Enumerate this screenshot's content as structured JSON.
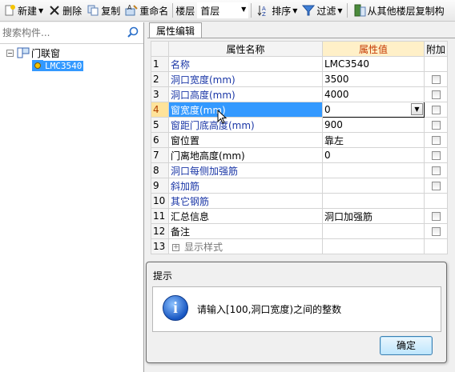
{
  "toolbar": {
    "new_label": "新建",
    "delete_label": "删除",
    "copy_label": "复制",
    "rename_label": "重命名",
    "floor_label": "楼层",
    "floor_value": "首层",
    "sort_label": "排序",
    "filter_label": "过滤",
    "copy_from_floor_label": "从其他楼层复制构"
  },
  "sidebar": {
    "search_placeholder": "搜索构件...",
    "tree": {
      "group_label": "门联窗",
      "item_label": "LMC3540"
    }
  },
  "panel": {
    "tab_label": "属性编辑",
    "columns": {
      "name": "属性名称",
      "value": "属性值",
      "extra": "附加"
    },
    "rows": [
      {
        "num": "1",
        "name": "名称",
        "value": "LMC3540",
        "checkbox": false
      },
      {
        "num": "2",
        "name": "洞口宽度(mm)",
        "value": "3500",
        "checkbox": true
      },
      {
        "num": "3",
        "name": "洞口高度(mm)",
        "value": "4000",
        "checkbox": true
      },
      {
        "num": "4",
        "name": "窗宽度(mm)",
        "value": "0",
        "checkbox": true
      },
      {
        "num": "5",
        "name": "窗距门底高度(mm)",
        "value": "900",
        "checkbox": true
      },
      {
        "num": "6",
        "name": "窗位置",
        "value": "靠左",
        "checkbox": true
      },
      {
        "num": "7",
        "name": "门离地高度(mm)",
        "value": "0",
        "checkbox": true
      },
      {
        "num": "8",
        "name": "洞口每侧加强筋",
        "value": "",
        "checkbox": true
      },
      {
        "num": "9",
        "name": "斜加筋",
        "value": "",
        "checkbox": true
      },
      {
        "num": "10",
        "name": "其它钢筋",
        "value": "",
        "checkbox": false
      },
      {
        "num": "11",
        "name": "汇总信息",
        "value": "洞口加强筋",
        "checkbox": true
      },
      {
        "num": "12",
        "name": "备注",
        "value": "",
        "checkbox": true
      },
      {
        "num": "13",
        "name": "显示样式",
        "value": "",
        "checkbox": false
      }
    ]
  },
  "dialog": {
    "title": "提示",
    "message": "请输入[100,洞口宽度)之间的整数",
    "ok_label": "确定"
  },
  "colors": {
    "selection": "#3399ff",
    "link_text": "#1a36a6",
    "header_value_bg": "#fff0c8"
  }
}
